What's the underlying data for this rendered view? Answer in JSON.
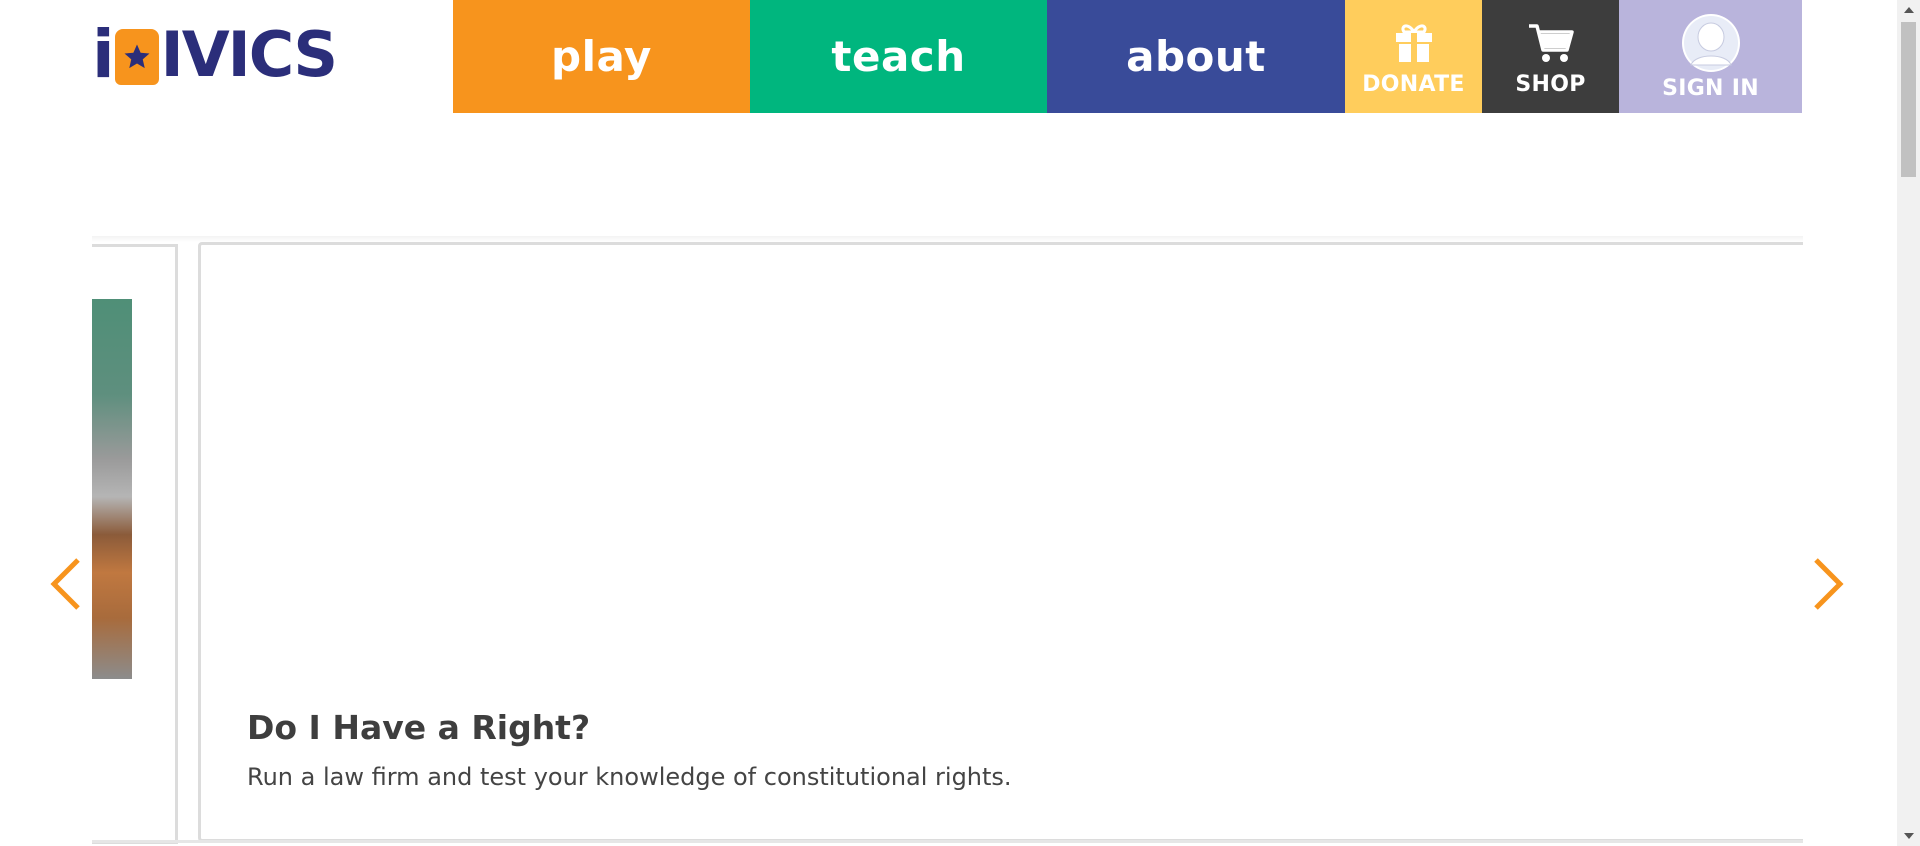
{
  "logo": {
    "letter_i": "i",
    "letters_after": "IVICS",
    "alt": "iCivics"
  },
  "nav": {
    "play": "play",
    "teach": "teach",
    "about": "about",
    "donate": "DONATE",
    "shop": "SHOP",
    "sign_in": "SIGN IN"
  },
  "icons": {
    "logo_star": "star-icon",
    "donate": "gift-icon",
    "shop": "cart-icon",
    "sign_in": "avatar-icon",
    "prev": "chevron-left-icon",
    "next": "chevron-right-icon"
  },
  "carousel": {
    "current_card": {
      "title": "Do I Have a Right?",
      "description": "Run a law firm and test your knowledge of constitutional rights."
    }
  },
  "colors": {
    "play": "#f7941d",
    "teach": "#00b67e",
    "about": "#394b99",
    "donate": "#ffcd5c",
    "shop": "#3d3d3d",
    "sign_in": "#b9b4dc",
    "logo_navy": "#2b2e7a",
    "arrow": "#f7941d"
  }
}
